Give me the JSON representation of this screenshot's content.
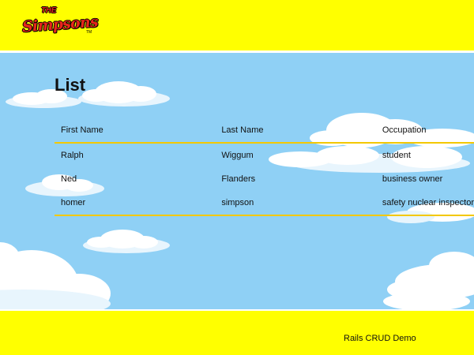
{
  "header": {
    "logo": {
      "line1": "THE",
      "line2": "Simpsons",
      "tm": "TM"
    },
    "background_color": "#ffff00"
  },
  "main": {
    "title": "List",
    "sky_color": "#8fd0f5",
    "table": {
      "columns": [
        "First Name",
        "Last Name",
        "Occupation"
      ],
      "rows": [
        [
          "Ralph",
          "Wiggum",
          "student"
        ],
        [
          "Ned",
          "Flanders",
          "business owner"
        ],
        [
          "homer",
          "simpson",
          "safety nuclear inspector"
        ]
      ],
      "rule_color": "#f3c800"
    }
  },
  "footer": {
    "text": "Rails CRUD Demo",
    "background_color": "#ffff00"
  }
}
